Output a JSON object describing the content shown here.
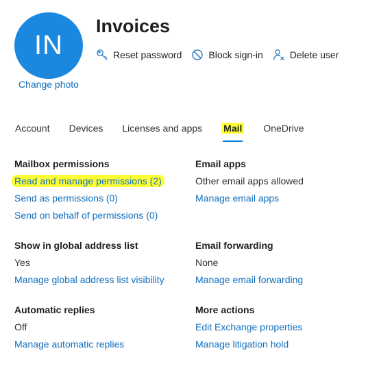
{
  "header": {
    "avatar_initials": "IN",
    "avatar_color": "#1b88e0",
    "change_photo": "Change photo",
    "title": "Invoices",
    "actions": [
      {
        "icon": "key-icon",
        "label": "Reset password"
      },
      {
        "icon": "block-icon",
        "label": "Block sign-in"
      },
      {
        "icon": "delete-user-icon",
        "label": "Delete user"
      }
    ]
  },
  "tabs": [
    "Account",
    "Devices",
    "Licenses and apps",
    "Mail",
    "OneDrive"
  ],
  "active_tab": "Mail",
  "colors": {
    "link": "#106ebe",
    "highlight": "#ffff33",
    "tab_underline": "#0078d4"
  },
  "sections": {
    "mailbox_permissions": {
      "title": "Mailbox permissions",
      "links": [
        "Read and manage permissions (2)",
        "Send as permissions (0)",
        "Send on behalf of permissions (0)"
      ]
    },
    "email_apps": {
      "title": "Email apps",
      "value": "Other email apps allowed",
      "link": "Manage email apps"
    },
    "global_address_list": {
      "title": "Show in global address list",
      "value": "Yes",
      "link": "Manage global address list visibility"
    },
    "email_forwarding": {
      "title": "Email forwarding",
      "value": "None",
      "link": "Manage email forwarding"
    },
    "automatic_replies": {
      "title": "Automatic replies",
      "value": "Off",
      "link": "Manage automatic replies"
    },
    "more_actions": {
      "title": "More actions",
      "links": [
        "Edit Exchange properties",
        "Manage litigation hold"
      ]
    }
  }
}
